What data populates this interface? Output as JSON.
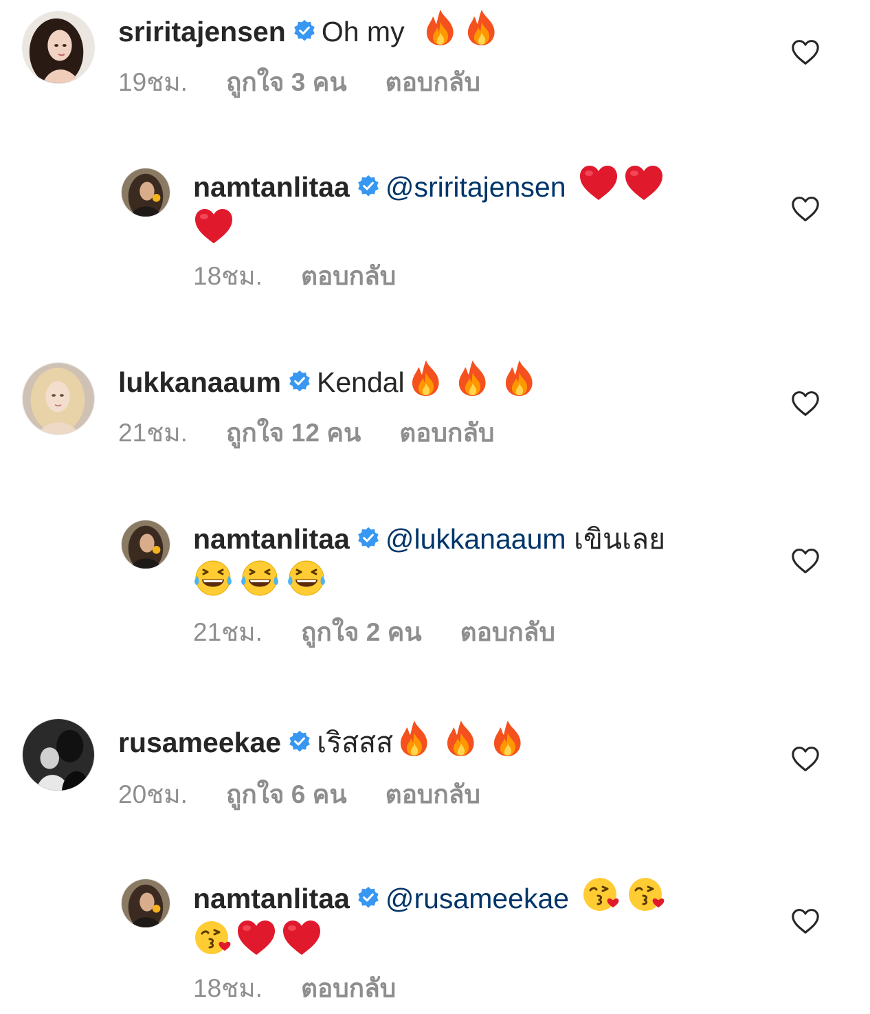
{
  "comments": [
    {
      "username": "sriritajensen",
      "text": "Oh my",
      "emojis": [
        "fire",
        "fire"
      ],
      "time": "19ชม.",
      "likes": "ถูกใจ 3 คน",
      "reply": "ตอบกลับ"
    },
    {
      "username": "namtanlitaa",
      "mention": "@sriritajensen",
      "emojis_line1": [
        "heart",
        "heart"
      ],
      "emojis_line2": [
        "heart"
      ],
      "time": "18ชม.",
      "reply": "ตอบกลับ"
    },
    {
      "username": "lukkanaaum",
      "text": "Kendal",
      "emojis": [
        "fire",
        "fire",
        "fire"
      ],
      "time": "21ชม.",
      "likes": "ถูกใจ 12 คน",
      "reply": "ตอบกลับ"
    },
    {
      "username": "namtanlitaa",
      "mention": "@lukkanaaum",
      "text": "เขินเลย",
      "emojis_line2": [
        "laughing-tears",
        "laughing-tears",
        "laughing-tears"
      ],
      "time": "21ชม.",
      "likes": "ถูกใจ 2 คน",
      "reply": "ตอบกลับ"
    },
    {
      "username": "rusameekae",
      "text": "เริสสส",
      "emojis": [
        "fire",
        "fire",
        "fire"
      ],
      "time": "20ชม.",
      "likes": "ถูกใจ 6 คน",
      "reply": "ตอบกลับ"
    },
    {
      "username": "namtanlitaa",
      "mention": "@rusameekae",
      "emojis_line1": [
        "kiss",
        "kiss"
      ],
      "emojis_line2": [
        "kiss",
        "heart",
        "heart"
      ],
      "time": "18ชม.",
      "reply": "ตอบกลับ"
    }
  ],
  "colors": {
    "text": "#262626",
    "secondary": "#8e8e8e",
    "mention": "#003569",
    "verified": "#3897f0"
  },
  "icons": {
    "like": "heart-outline-icon",
    "verified": "verified-badge-icon"
  }
}
